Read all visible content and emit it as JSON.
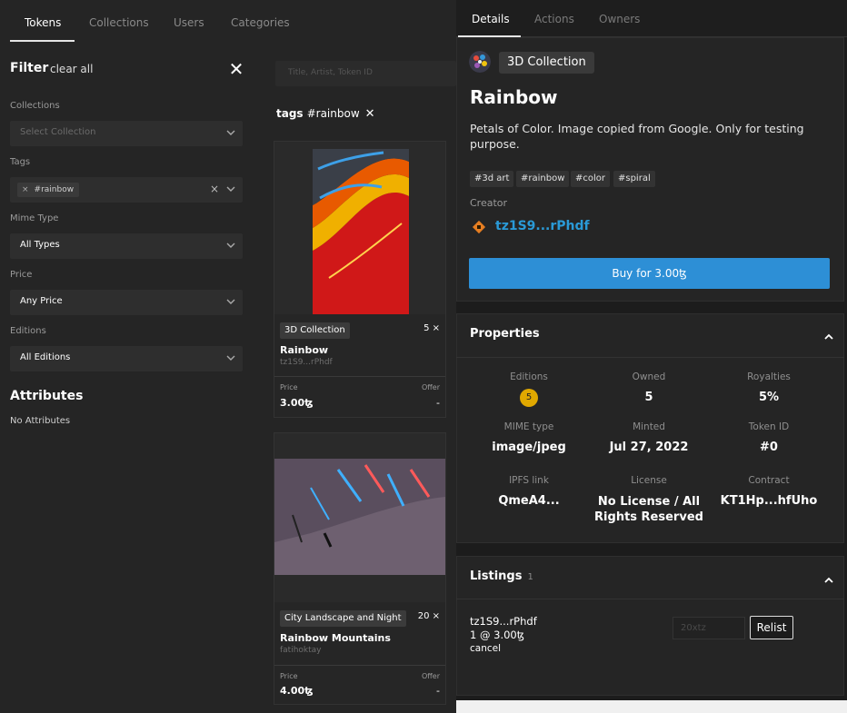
{
  "browse": {
    "tabs": [
      "Tokens",
      "Collections",
      "Users",
      "Categories"
    ],
    "filter": {
      "title": "Filter",
      "clear_all": "clear all",
      "close_glyph": "✕",
      "collections": {
        "label": "Collections",
        "placeholder": "Select Collection"
      },
      "tags": {
        "label": "Tags",
        "chip": "#rainbow",
        "chip_x": "×",
        "clear_glyph": "×"
      },
      "mime": {
        "label": "Mime Type",
        "value": "All Types"
      },
      "price": {
        "label": "Price",
        "value": "Any Price"
      },
      "editions": {
        "label": "Editions",
        "value": "All Editions"
      }
    },
    "attributes": {
      "title": "Attributes",
      "empty": "No Attributes"
    },
    "search_placeholder": "Title, Artist, Token ID",
    "tag_heading": {
      "prefix": "tags",
      "tag": "#rainbow",
      "close_glyph": "✕"
    },
    "cards": [
      {
        "collection": "3D Collection",
        "editions": "5 ×",
        "name": "Rainbow",
        "creator": "tz1S9...rPhdf",
        "price_label": "Price",
        "offer_label": "Offer",
        "price": "3.00ꜩ",
        "offer": "-"
      },
      {
        "collection": "City Landscape and Night",
        "editions": "20 ×",
        "name": "Rainbow Mountains",
        "creator": "fatihoktay",
        "price_label": "Price",
        "offer_label": "Offer",
        "price": "4.00ꜩ",
        "offer": "-"
      }
    ]
  },
  "detail": {
    "tabs": [
      "Details",
      "Actions",
      "Owners"
    ],
    "collection": "3D Collection",
    "title": "Rainbow",
    "description": "Petals of Color. Image copied from Google. Only for testing purpose.",
    "tags": [
      "#3d art",
      "#rainbow",
      "#color",
      "#spiral"
    ],
    "creator_label": "Creator",
    "creator": "tz1S9...rPhdf",
    "buy_label": "Buy for 3.00ꜩ",
    "properties": {
      "title": "Properties",
      "items": [
        {
          "label": "Editions",
          "value": "5"
        },
        {
          "label": "Owned",
          "value": "5"
        },
        {
          "label": "Royalties",
          "value": "5%"
        },
        {
          "label": "MIME type",
          "value": "image/jpeg"
        },
        {
          "label": "Minted",
          "value": "Jul 27, 2022"
        },
        {
          "label": "Token ID",
          "value": "#0"
        },
        {
          "label": "IPFS link",
          "value": "QmeA4..."
        },
        {
          "label": "License",
          "value": "No License / All Rights Reserved"
        },
        {
          "label": "Contract",
          "value": "KT1Hp...hfUho"
        }
      ]
    },
    "listings": {
      "title": "Listings",
      "count": "1",
      "seller": "tz1S9...rPhdf",
      "qty_price": "1 @ 3.00ꜩ",
      "cancel": "cancel",
      "relist_placeholder": "20xtz",
      "relist_label": "Relist"
    }
  },
  "colors": {
    "accent": "#2d8fd6",
    "link": "#2a9ad7",
    "edition_badge": "#e0a800"
  }
}
